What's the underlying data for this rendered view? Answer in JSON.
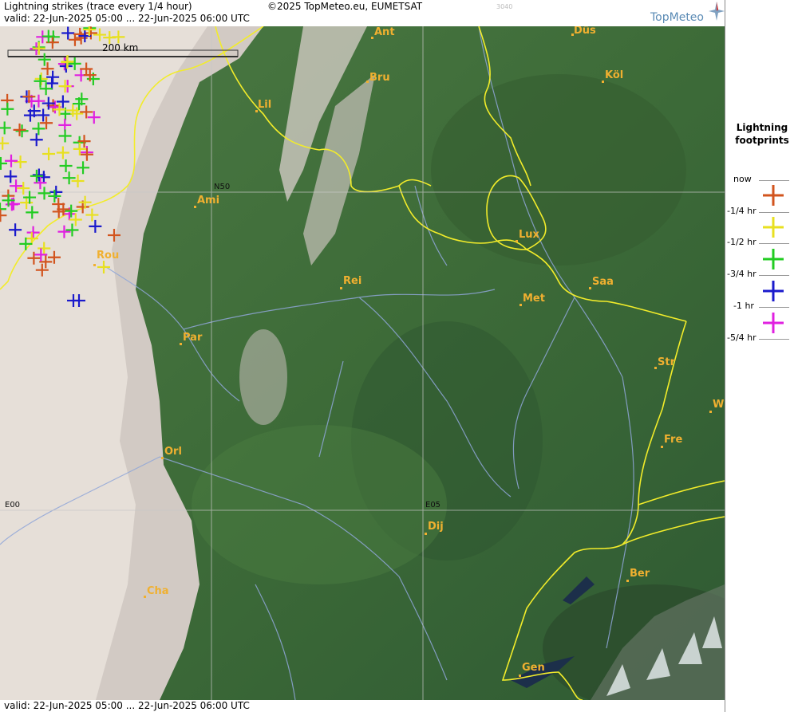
{
  "header": {
    "title": "Lightning strikes (trace every 1/4 hour)",
    "valid": "valid:  22-Jun-2025 05:00 ... 22-Jun-2025 06:00 UTC",
    "copyright": "©2025 TopMeteo.eu, EUMETSAT",
    "code": "3040",
    "logo": "TopMeteo"
  },
  "footer": {
    "valid": "valid:  22-Jun-2025 05:00 ... 22-Jun-2025 06:00 UTC"
  },
  "scale": {
    "label": "200 km"
  },
  "grid_labels": {
    "n50": "N50",
    "e00": "E00",
    "e05": "E05"
  },
  "cities": [
    "Ant",
    "Düs",
    "Bru",
    "Köl",
    "Lil",
    "Ami",
    "Lux",
    "Rei",
    "Saa",
    "Met",
    "Rou",
    "Par",
    "Str",
    "W",
    "Fre",
    "Orl",
    "Dij",
    "Ber",
    "Cha",
    "Gen"
  ],
  "legend": {
    "title_line1": "Lightning",
    "title_line2": "footprints",
    "items": [
      {
        "label": "now",
        "color": null
      },
      {
        "label": "-1/4 hr",
        "color": "#d2541e"
      },
      {
        "label": "-1/2 hr",
        "color": "#e8e020"
      },
      {
        "label": "-3/4 hr",
        "color": "#22cc22"
      },
      {
        "label": "-1 hr",
        "color": "#1a1acc"
      },
      {
        "label": "-5/4 hr",
        "color": "#e020e0"
      }
    ]
  }
}
